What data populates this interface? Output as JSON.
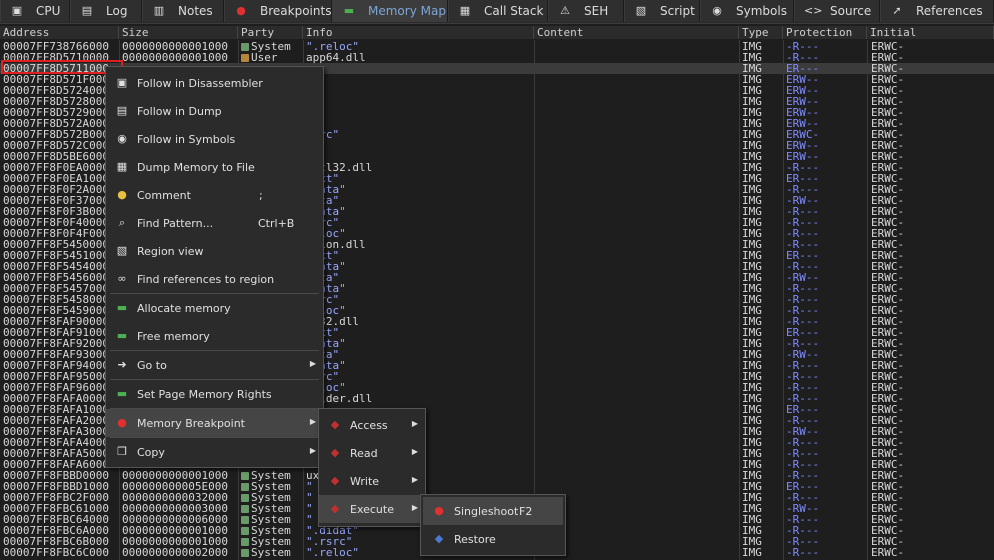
{
  "tabs": [
    {
      "label": "CPU",
      "icon": "cpu-icon",
      "glyph": "▣"
    },
    {
      "label": "Log",
      "icon": "log-icon",
      "glyph": "▤"
    },
    {
      "label": "Notes",
      "icon": "notes-icon",
      "glyph": "▥"
    },
    {
      "label": "Breakpoints",
      "icon": "breakpoints-icon",
      "glyph": "●"
    },
    {
      "label": "Memory Map",
      "icon": "memory-map-icon",
      "glyph": "▬"
    },
    {
      "label": "Call Stack",
      "icon": "call-stack-icon",
      "glyph": "▦"
    },
    {
      "label": "SEH",
      "icon": "seh-icon",
      "glyph": "⚠"
    },
    {
      "label": "Script",
      "icon": "script-icon",
      "glyph": "▧"
    },
    {
      "label": "Symbols",
      "icon": "symbols-icon",
      "glyph": "◉"
    },
    {
      "label": "Source",
      "icon": "source-icon",
      "glyph": "<>"
    },
    {
      "label": "References",
      "icon": "references-icon",
      "glyph": "➚"
    }
  ],
  "active_tab": "Memory Map",
  "columns": [
    "Address",
    "Size",
    "Party",
    "Info",
    "Content",
    "Type",
    "Protection",
    "Initial"
  ],
  "rows": [
    {
      "addr": "00007FF738766000",
      "size": "0000000000001000",
      "party": "System",
      "info": "\".reloc\"",
      "q": true,
      "type": "IMG",
      "prot": "-R---",
      "init": "ERWC-"
    },
    {
      "addr": "00007FF8D5710000",
      "size": "0000000000001000",
      "party": "User",
      "info": "app64.dll",
      "q": false,
      "type": "IMG",
      "prot": "-R---",
      "init": "ERWC-"
    },
    {
      "addr": "00007FF8D5711000",
      "size": "",
      "party": "",
      "info": "",
      "q": false,
      "type": "IMG",
      "prot": "ER---",
      "init": "ERWC-"
    },
    {
      "addr": "00007FF8D571F000",
      "size": "",
      "party": "",
      "info": "",
      "q": false,
      "type": "IMG",
      "prot": "ERW--",
      "init": "ERWC-"
    },
    {
      "addr": "00007FF8D5724000",
      "size": "",
      "party": "",
      "info": "",
      "q": false,
      "type": "IMG",
      "prot": "ERW--",
      "init": "ERWC-"
    },
    {
      "addr": "00007FF8D5728000",
      "size": "",
      "party": "",
      "info": "",
      "q": false,
      "type": "IMG",
      "prot": "ERW--",
      "init": "ERWC-"
    },
    {
      "addr": "00007FF8D5729000",
      "size": "",
      "party": "",
      "info": "",
      "q": false,
      "type": "IMG",
      "prot": "ERW--",
      "init": "ERWC-"
    },
    {
      "addr": "00007FF8D572A000",
      "size": "",
      "party": "",
      "info": "",
      "q": false,
      "type": "IMG",
      "prot": "ERW--",
      "init": "ERWC-"
    },
    {
      "addr": "00007FF8D572B000",
      "size": "",
      "party": "",
      "info": "rsrc\"",
      "q": true,
      "type": "IMG",
      "prot": "ERWC-",
      "init": "ERWC-"
    },
    {
      "addr": "00007FF8D572C000",
      "size": "",
      "party": "",
      "info": "",
      "q": false,
      "type": "IMG",
      "prot": "ERW--",
      "init": "ERWC-"
    },
    {
      "addr": "00007FF8D5BE6000",
      "size": "",
      "party": "",
      "info": "",
      "q": false,
      "type": "IMG",
      "prot": "ERW--",
      "init": "ERWC-"
    },
    {
      "addr": "00007FF8F0EA0000",
      "size": "",
      "party": "",
      "info": "nctl32.dll",
      "q": false,
      "type": "IMG",
      "prot": "-R---",
      "init": "ERWC-"
    },
    {
      "addr": "00007FF8F0EA1000",
      "size": "",
      "party": "",
      "info": "text\"",
      "q": true,
      "type": "IMG",
      "prot": "ER---",
      "init": "ERWC-"
    },
    {
      "addr": "00007FF8F0F2A000",
      "size": "",
      "party": "",
      "info": "rdata\"",
      "q": true,
      "type": "IMG",
      "prot": "-R---",
      "init": "ERWC-"
    },
    {
      "addr": "00007FF8F0F37000",
      "size": "",
      "party": "",
      "info": "data\"",
      "q": true,
      "type": "IMG",
      "prot": "-RW--",
      "init": "ERWC-"
    },
    {
      "addr": "00007FF8F0F3B000",
      "size": "",
      "party": "",
      "info": "pdata\"",
      "q": true,
      "type": "IMG",
      "prot": "-R---",
      "init": "ERWC-"
    },
    {
      "addr": "00007FF8F0F40000",
      "size": "",
      "party": "",
      "info": "rsrc\"",
      "q": true,
      "type": "IMG",
      "prot": "-R---",
      "init": "ERWC-"
    },
    {
      "addr": "00007FF8F0F4F000",
      "size": "",
      "party": "",
      "info": "reloc\"",
      "q": true,
      "type": "IMG",
      "prot": "-R---",
      "init": "ERWC-"
    },
    {
      "addr": "00007FF8F5450000",
      "size": "",
      "party": "",
      "info": "rsion.dll",
      "q": false,
      "type": "IMG",
      "prot": "-R---",
      "init": "ERWC-"
    },
    {
      "addr": "00007FF8F5451000",
      "size": "",
      "party": "",
      "info": "text\"",
      "q": true,
      "type": "IMG",
      "prot": "ER---",
      "init": "ERWC-"
    },
    {
      "addr": "00007FF8F5454000",
      "size": "",
      "party": "",
      "info": "rdata\"",
      "q": true,
      "type": "IMG",
      "prot": "-R---",
      "init": "ERWC-"
    },
    {
      "addr": "00007FF8F5456000",
      "size": "",
      "party": "",
      "info": "data\"",
      "q": true,
      "type": "IMG",
      "prot": "-RW--",
      "init": "ERWC-"
    },
    {
      "addr": "00007FF8F5457000",
      "size": "",
      "party": "",
      "info": "pdata\"",
      "q": true,
      "type": "IMG",
      "prot": "-R---",
      "init": "ERWC-"
    },
    {
      "addr": "00007FF8F5458000",
      "size": "",
      "party": "",
      "info": "rsrc\"",
      "q": true,
      "type": "IMG",
      "prot": "-R---",
      "init": "ERWC-"
    },
    {
      "addr": "00007FF8F5459000",
      "size": "",
      "party": "",
      "info": "reloc\"",
      "q": true,
      "type": "IMG",
      "prot": "-R---",
      "init": "ERWC-"
    },
    {
      "addr": "00007FF8FAF90000",
      "size": "",
      "party": "",
      "info": "mg32.dll",
      "q": false,
      "type": "IMG",
      "prot": "-R---",
      "init": "ERWC-"
    },
    {
      "addr": "00007FF8FAF91000",
      "size": "",
      "party": "",
      "info": "text\"",
      "q": true,
      "type": "IMG",
      "prot": "ER---",
      "init": "ERWC-"
    },
    {
      "addr": "00007FF8FAF92000",
      "size": "",
      "party": "",
      "info": "rdata\"",
      "q": true,
      "type": "IMG",
      "prot": "-R---",
      "init": "ERWC-"
    },
    {
      "addr": "00007FF8FAF93000",
      "size": "",
      "party": "",
      "info": "data\"",
      "q": true,
      "type": "IMG",
      "prot": "-RW--",
      "init": "ERWC-"
    },
    {
      "addr": "00007FF8FAF94000",
      "size": "",
      "party": "",
      "info": "pdata\"",
      "q": true,
      "type": "IMG",
      "prot": "-R---",
      "init": "ERWC-"
    },
    {
      "addr": "00007FF8FAF95000",
      "size": "",
      "party": "",
      "info": "rsrc\"",
      "q": true,
      "type": "IMG",
      "prot": "-R---",
      "init": "ERWC-"
    },
    {
      "addr": "00007FF8FAF96000",
      "size": "",
      "party": "",
      "info": "reloc\"",
      "q": true,
      "type": "IMG",
      "prot": "-R---",
      "init": "ERWC-"
    },
    {
      "addr": "00007FF8FAFA0000",
      "size": "",
      "party": "",
      "info": "folder.dll",
      "q": false,
      "type": "IMG",
      "prot": "-R---",
      "init": "ERWC-"
    },
    {
      "addr": "00007FF8FAFA1000",
      "size": "",
      "party": "",
      "info": "",
      "q": false,
      "type": "IMG",
      "prot": "ER---",
      "init": "ERWC-"
    },
    {
      "addr": "00007FF8FAFA2000",
      "size": "",
      "party": "",
      "info": "",
      "q": false,
      "type": "IMG",
      "prot": "-R---",
      "init": "ERWC-"
    },
    {
      "addr": "00007FF8FAFA3000",
      "size": "",
      "party": "",
      "info": "",
      "q": false,
      "type": "IMG",
      "prot": "-RW--",
      "init": "ERWC-"
    },
    {
      "addr": "00007FF8FAFA4000",
      "size": "",
      "party": "",
      "info": "",
      "q": false,
      "type": "IMG",
      "prot": "-R---",
      "init": "ERWC-"
    },
    {
      "addr": "00007FF8FAFA5000",
      "size": "",
      "party": "",
      "info": "",
      "q": false,
      "type": "IMG",
      "prot": "-R---",
      "init": "ERWC-"
    },
    {
      "addr": "00007FF8FAFA6000",
      "size": "",
      "party": "",
      "info": "",
      "q": false,
      "type": "IMG",
      "prot": "-R---",
      "init": "ERWC-"
    },
    {
      "addr": "00007FF8FBBD0000",
      "size": "0000000000001000",
      "party": "System",
      "info": "ux",
      "q": false,
      "type": "IMG",
      "prot": "-R---",
      "init": "ERWC-"
    },
    {
      "addr": "00007FF8FBBD1000",
      "size": "000000000005E000",
      "party": "System",
      "info": "\"",
      "q": true,
      "type": "IMG",
      "prot": "ER---",
      "init": "ERWC-"
    },
    {
      "addr": "00007FF8FBC2F000",
      "size": "0000000000032000",
      "party": "System",
      "info": "\"",
      "q": true,
      "type": "IMG",
      "prot": "-R---",
      "init": "ERWC-"
    },
    {
      "addr": "00007FF8FBC61000",
      "size": "0000000000003000",
      "party": "System",
      "info": "\"",
      "q": true,
      "type": "IMG",
      "prot": "-RW--",
      "init": "ERWC-"
    },
    {
      "addr": "00007FF8FBC64000",
      "size": "0000000000006000",
      "party": "System",
      "info": "\"",
      "q": true,
      "type": "IMG",
      "prot": "-R---",
      "init": "ERWC-"
    },
    {
      "addr": "00007FF8FBC6A000",
      "size": "0000000000001000",
      "party": "System",
      "info": "\".didat\"",
      "q": true,
      "type": "IMG",
      "prot": "-R---",
      "init": "ERWC-"
    },
    {
      "addr": "00007FF8FBC6B000",
      "size": "0000000000001000",
      "party": "System",
      "info": "\".rsrc\"",
      "q": true,
      "type": "IMG",
      "prot": "-R---",
      "init": "ERWC-"
    },
    {
      "addr": "00007FF8FBC6C000",
      "size": "0000000000002000",
      "party": "System",
      "info": "\".reloc\"",
      "q": true,
      "type": "IMG",
      "prot": "-R---",
      "init": "ERWC-"
    }
  ],
  "context_menu": [
    {
      "label": "Follow in Disassembler",
      "shortcut": "",
      "icon": "disassembler-icon",
      "glyph": "▣"
    },
    {
      "label": "Follow in Dump",
      "shortcut": "",
      "icon": "dump-icon",
      "glyph": "▤"
    },
    {
      "label": "Follow in Symbols",
      "shortcut": "",
      "icon": "symbols-icon",
      "glyph": "◉"
    },
    {
      "label": "Dump Memory to File",
      "shortcut": "",
      "icon": "save-dump-icon",
      "glyph": "▦"
    },
    {
      "label": "Comment",
      "shortcut": ";",
      "icon": "comment-icon",
      "glyph": "●"
    },
    {
      "label": "Find Pattern...",
      "shortcut": "Ctrl+B",
      "icon": "find-pattern-icon",
      "glyph": "⌕"
    },
    {
      "label": "Region view",
      "shortcut": "",
      "icon": "region-view-icon",
      "glyph": "▧"
    },
    {
      "label": "Find references to region",
      "shortcut": "",
      "icon": "binoculars-icon",
      "glyph": "∞"
    },
    {
      "label": "Allocate memory",
      "shortcut": "",
      "icon": "allocate-memory-icon",
      "glyph": "▬"
    },
    {
      "label": "Free memory",
      "shortcut": "",
      "icon": "free-memory-icon",
      "glyph": "▬"
    },
    {
      "label": "Go to",
      "shortcut": "",
      "icon": "goto-icon",
      "glyph": "➜",
      "submenu": true
    },
    {
      "label": "Set Page Memory Rights",
      "shortcut": "",
      "icon": "page-rights-icon",
      "glyph": "▬"
    },
    {
      "label": "Memory Breakpoint",
      "shortcut": "",
      "icon": "breakpoint-icon",
      "glyph": "●",
      "submenu": true
    },
    {
      "label": "Copy",
      "shortcut": "",
      "icon": "copy-icon",
      "glyph": "❐",
      "submenu": true
    }
  ],
  "breakpoint_submenu": [
    {
      "label": "Access",
      "icon": "access-bp-icon",
      "glyph": "◆"
    },
    {
      "label": "Read",
      "icon": "read-bp-icon",
      "glyph": "◆"
    },
    {
      "label": "Write",
      "icon": "write-bp-icon",
      "glyph": "◆"
    },
    {
      "label": "Execute",
      "icon": "execute-bp-icon",
      "glyph": "◆"
    }
  ],
  "execute_submenu": [
    {
      "label": "Singleshoot",
      "shortcut": "F2",
      "icon": "singleshoot-icon",
      "glyph": "●"
    },
    {
      "label": "Restore",
      "shortcut": "",
      "icon": "restore-icon",
      "glyph": "◆"
    }
  ]
}
